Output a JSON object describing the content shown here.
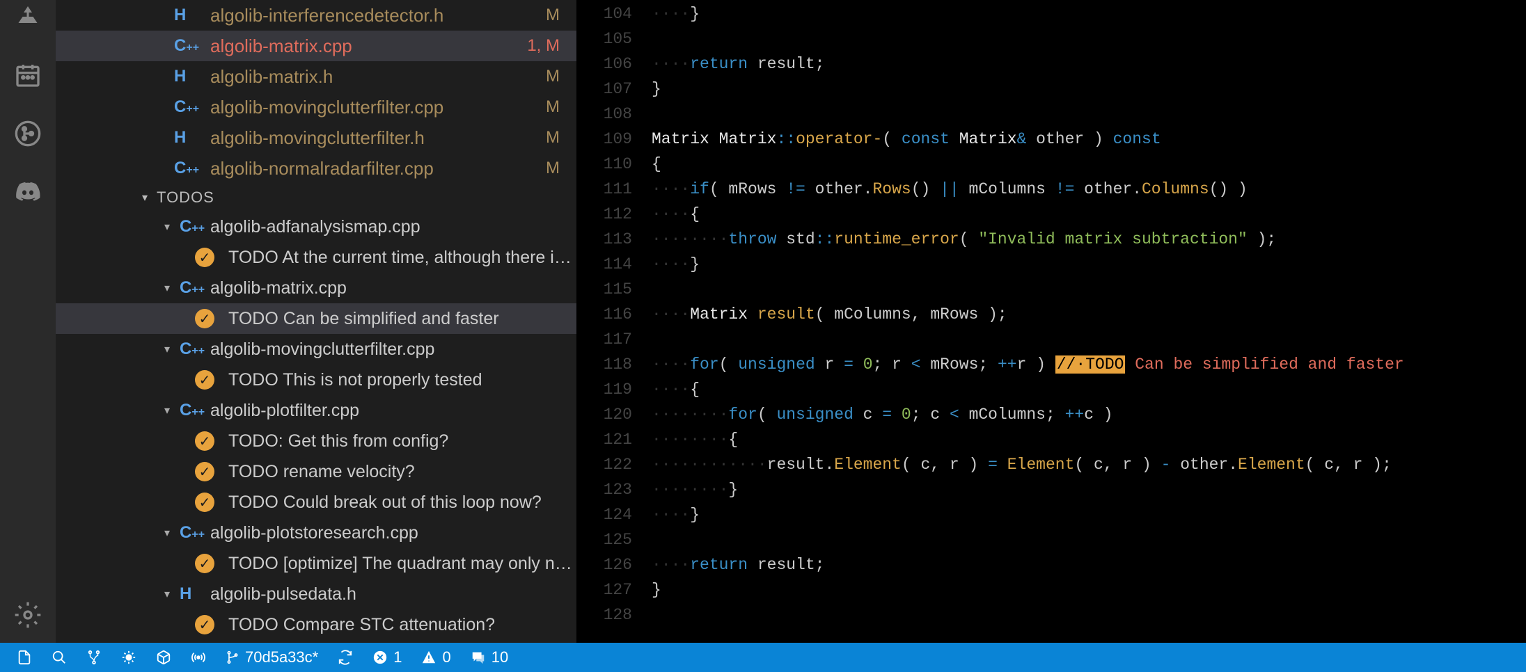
{
  "files": [
    {
      "icon": "H",
      "name": "algolib-interferencedetector.h",
      "badge": "M",
      "sel": false
    },
    {
      "icon": "C++",
      "name": "algolib-matrix.cpp",
      "badge": "1, M",
      "sel": true
    },
    {
      "icon": "H",
      "name": "algolib-matrix.h",
      "badge": "M",
      "sel": false
    },
    {
      "icon": "C++",
      "name": "algolib-movingclutterfilter.cpp",
      "badge": "M",
      "sel": false
    },
    {
      "icon": "H",
      "name": "algolib-movingclutterfilter.h",
      "badge": "M",
      "sel": false
    },
    {
      "icon": "C++",
      "name": "algolib-normalradarfilter.cpp",
      "badge": "M",
      "sel": false
    }
  ],
  "section": "TODOS",
  "todos": [
    {
      "file": "algolib-adfanalysismap.cpp",
      "icon": "C++",
      "items": [
        "TODO At the current time, although there is s…"
      ]
    },
    {
      "file": "algolib-matrix.cpp",
      "icon": "C++",
      "items": [
        "TODO Can be simplified and faster"
      ],
      "selIdx": 0
    },
    {
      "file": "algolib-movingclutterfilter.cpp",
      "icon": "C++",
      "items": [
        "TODO This is not properly tested"
      ]
    },
    {
      "file": "algolib-plotfilter.cpp",
      "icon": "C++",
      "items": [
        "TODO: Get this from config?",
        "TODO rename velocity?",
        "TODO Could break out of this loop now?"
      ]
    },
    {
      "file": "algolib-plotstoresearch.cpp",
      "icon": "C++",
      "items": [
        "TODO [optimize] The quadrant may only need…"
      ]
    },
    {
      "file": "algolib-pulsedata.h",
      "icon": "H",
      "items": [
        "TODO Compare STC attenuation?"
      ]
    }
  ],
  "lines": {
    "start": 104,
    "end": 128
  },
  "code": {
    "104": {
      "indent": "····",
      "text": "}",
      "class": ""
    },
    "105": {
      "indent": "",
      "text": "",
      "class": ""
    },
    "106": {
      "indent": "····",
      "kw": "return",
      "text": " result;",
      "class": ""
    },
    "107": {
      "indent": "",
      "text": "}",
      "class": ""
    },
    "108": {
      "indent": "",
      "text": "",
      "class": ""
    },
    "109": {
      "raw": true
    },
    "110": {
      "indent": "",
      "text": "{",
      "class": ""
    },
    "111": {
      "raw": true
    },
    "112": {
      "indent": "····",
      "text": "{",
      "class": ""
    },
    "113": {
      "raw": true
    },
    "114": {
      "indent": "····",
      "text": "}",
      "class": ""
    },
    "115": {
      "indent": "",
      "text": "",
      "class": ""
    },
    "116": {
      "raw": true
    },
    "117": {
      "indent": "",
      "text": "",
      "class": ""
    },
    "118": {
      "raw": true
    },
    "119": {
      "indent": "····",
      "text": "{",
      "class": ""
    },
    "120": {
      "raw": true
    },
    "121": {
      "indent": "········",
      "text": "{",
      "class": ""
    },
    "122": {
      "raw": true
    },
    "123": {
      "indent": "········",
      "text": "}",
      "class": ""
    },
    "124": {
      "indent": "····",
      "text": "}",
      "class": ""
    },
    "125": {
      "indent": "",
      "text": "",
      "class": ""
    },
    "126": {
      "indent": "····",
      "kw": "return",
      "text": " result;",
      "class": ""
    },
    "127": {
      "indent": "",
      "text": "}",
      "class": ""
    },
    "128": {
      "indent": "",
      "text": "",
      "class": ""
    }
  },
  "statusbar": {
    "branch": "70d5a33c*",
    "errors": "1",
    "warnings": "0",
    "comments": "10"
  }
}
